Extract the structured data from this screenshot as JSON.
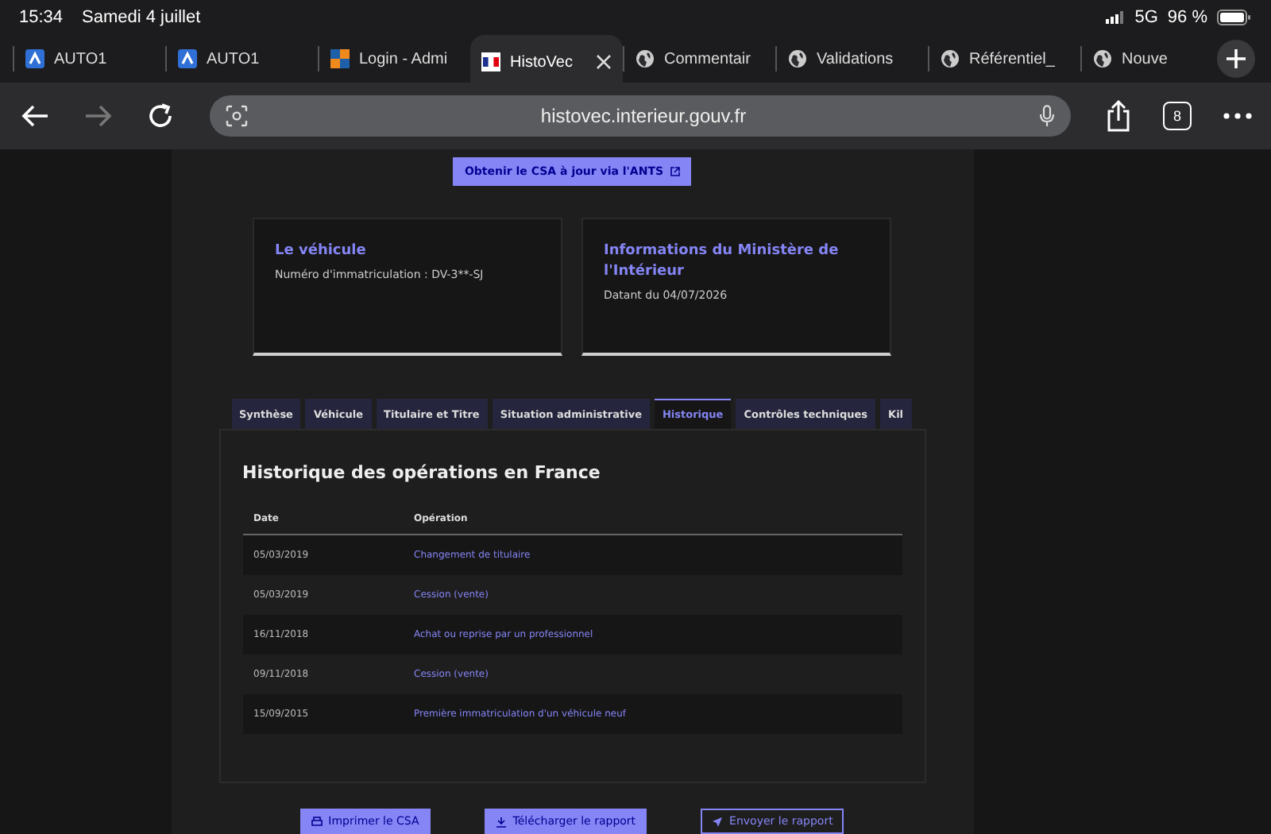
{
  "status_bar": {
    "time": "15:34",
    "date": "Samedi 4 juillet",
    "network": "5G",
    "battery": "96 %"
  },
  "browser_tabs": [
    {
      "title": "AUTO1",
      "kind": "auto1",
      "selected": false
    },
    {
      "title": "AUTO1",
      "kind": "auto1",
      "selected": false
    },
    {
      "title": "Login - Admi",
      "kind": "squares",
      "selected": false
    },
    {
      "title": "HistoVec",
      "kind": "flag",
      "selected": true
    },
    {
      "title": "Commentair",
      "kind": "globe",
      "selected": false
    },
    {
      "title": "Validations",
      "kind": "globe",
      "selected": false
    },
    {
      "title": "Référentiel_",
      "kind": "globe",
      "selected": false
    },
    {
      "title": "Nouve",
      "kind": "globe",
      "selected": false
    }
  ],
  "toolbar": {
    "url": "histovec.interieur.gouv.fr",
    "tab_count": "8",
    "forward_disabled": true
  },
  "page": {
    "csa_button": "Obtenir le CSA à jour via l'ANTS",
    "cards": [
      {
        "title": "Le véhicule",
        "text": "Numéro d'immatriculation : DV-3**-SJ"
      },
      {
        "title": "Informations du Ministère de l'Intérieur",
        "text": "Datant du 04/07/2026"
      }
    ],
    "tabs": [
      {
        "label": "Synthèse",
        "selected": false
      },
      {
        "label": "Véhicule",
        "selected": false
      },
      {
        "label": "Titulaire et Titre",
        "selected": false
      },
      {
        "label": "Situation administrative",
        "selected": false
      },
      {
        "label": "Historique",
        "selected": true
      },
      {
        "label": "Contrôles techniques",
        "selected": false
      },
      {
        "label": "Kil",
        "selected": false
      }
    ],
    "panel_title": "Historique des opérations en France",
    "table": {
      "columns": [
        "Date",
        "Opération"
      ],
      "rows": [
        [
          "05/03/2019",
          "Changement de titulaire"
        ],
        [
          "05/03/2019",
          "Cession (vente)"
        ],
        [
          "16/11/2018",
          "Achat ou reprise par un professionnel"
        ],
        [
          "09/11/2018",
          "Cession (vente)"
        ],
        [
          "15/09/2015",
          "Première immatriculation d'un véhicule neuf"
        ]
      ]
    },
    "actions": [
      {
        "label": "Imprimer le CSA",
        "kind": "print"
      },
      {
        "label": "Télécharger le rapport",
        "kind": "download"
      },
      {
        "label": "Envoyer le rapport",
        "kind": "send"
      }
    ]
  }
}
